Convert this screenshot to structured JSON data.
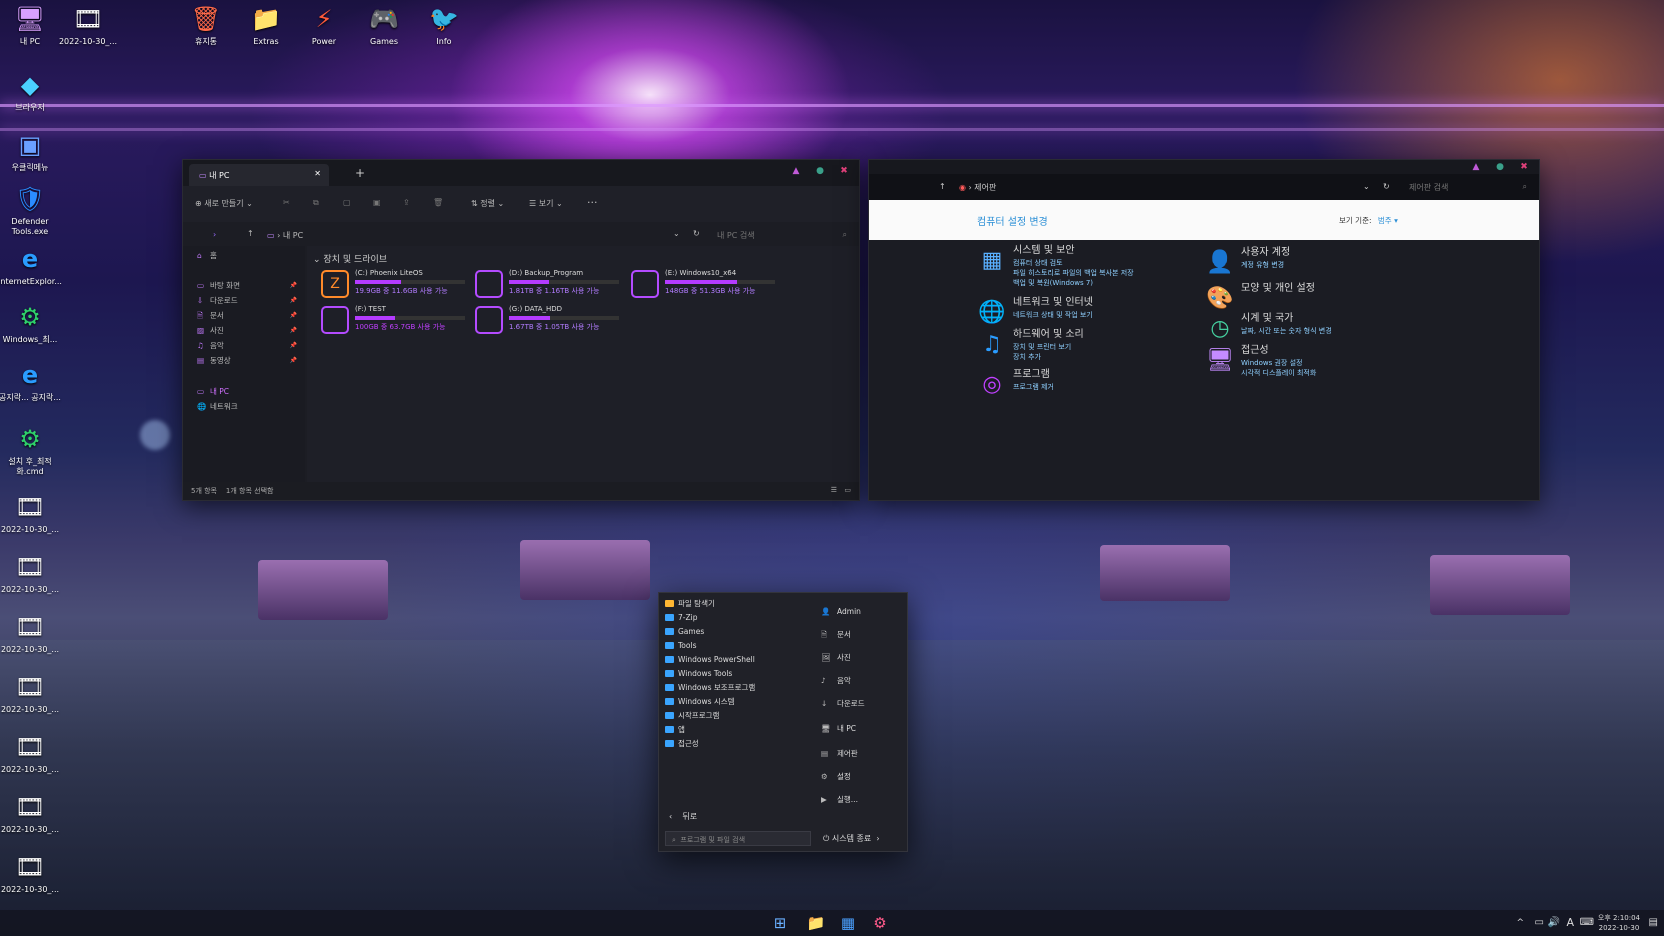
{
  "desktop": {
    "icons": [
      {
        "label": "내 PC",
        "glyph": "🖥"
      },
      {
        "label": "2022-10-30_...",
        "glyph": "🎞"
      },
      {
        "label": "휴지통",
        "glyph": "🗑"
      },
      {
        "label": "Extras",
        "glyph": "📁"
      },
      {
        "label": "Power",
        "glyph": "⚡"
      },
      {
        "label": "Games",
        "glyph": "🎮"
      },
      {
        "label": "Info",
        "glyph": "🐦"
      },
      {
        "label": "브라우저",
        "glyph": "◆"
      },
      {
        "label": "우클릭메뉴",
        "glyph": "▣"
      },
      {
        "label": "Defender Tools.exe",
        "glyph": "🛡"
      },
      {
        "label": "InternetExplor...",
        "glyph": "e"
      },
      {
        "label": "Windows_최...",
        "glyph": "⚙"
      },
      {
        "label": "공지락... 공지락...",
        "glyph": "e"
      },
      {
        "label": "설치 후_최적화.cmd",
        "glyph": "⚙"
      },
      {
        "label": "2022-10-30_...",
        "glyph": "🎞"
      },
      {
        "label": "2022-10-30_...",
        "glyph": "🎞"
      },
      {
        "label": "2022-10-30_...",
        "glyph": "🎞"
      },
      {
        "label": "2022-10-30_...",
        "glyph": "🎞"
      },
      {
        "label": "2022-10-30_...",
        "glyph": "🎞"
      },
      {
        "label": "2022-10-30_...",
        "glyph": "🎞"
      },
      {
        "label": "2022-10-30_..."
      }
    ]
  },
  "explorer": {
    "tab": "내 PC",
    "new_tab": "+",
    "toolbar": {
      "new": "새로 만들기",
      "sort": "정렬",
      "view": "보기",
      "more": "···"
    },
    "path": "내 PC",
    "search_placeholder": "내 PC 검색",
    "sidebar": {
      "home": "홈",
      "items": [
        "바탕 화면",
        "다운로드",
        "문서",
        "사진",
        "음악",
        "동영상"
      ],
      "this_pc": "내 PC",
      "network": "네트워크"
    },
    "section": "장치 및 드라이브",
    "drives": [
      {
        "name": "(C:) Phoenix LiteOS",
        "size": "19.9GB 중 11.6GB 사용 가능",
        "used": 0.42
      },
      {
        "name": "(D:) Backup_Program",
        "size": "1.81TB 중 1.16TB 사용 가능",
        "used": 0.36
      },
      {
        "name": "(E:) Windows10_x64",
        "size": "148GB 중 51.3GB 사용 가능",
        "used": 0.65
      },
      {
        "name": "(F:) TEST",
        "size": "100GB 중 63.7GB 사용 가능",
        "used": 0.36
      },
      {
        "name": "(G:) DATA_HDD",
        "size": "1.67TB 중 1.05TB 사용 가능",
        "used": 0.37
      }
    ],
    "status": {
      "count": "5개 항목",
      "selected": "1개 항목 선택함"
    }
  },
  "control_panel": {
    "path": "제어판",
    "search_placeholder": "제어판 검색",
    "heading": "컴퓨터 설정 변경",
    "view_by_label": "보기 기준:",
    "view_by_value": "범주",
    "left": [
      {
        "title": "시스템 및 보안",
        "subs": [
          "컴퓨터 상태 검토",
          "파일 히스토리로 파일의 백업 복사본 저장",
          "백업 및 복원(Windows 7)"
        ],
        "glyph": "▦"
      },
      {
        "title": "네트워크 및 인터넷",
        "subs": [
          "네트워크 상태 및 작업 보기"
        ],
        "glyph": "🌐"
      },
      {
        "title": "하드웨어 및 소리",
        "subs": [
          "장치 및 프린터 보기",
          "장치 추가"
        ],
        "glyph": "♫"
      },
      {
        "title": "프로그램",
        "subs": [
          "프로그램 제거"
        ],
        "glyph": "◎"
      }
    ],
    "right": [
      {
        "title": "사용자 계정",
        "subs": [
          "계정 유형 변경"
        ],
        "glyph": "👤"
      },
      {
        "title": "모양 및 개인 설정",
        "subs": [],
        "glyph": "🎨"
      },
      {
        "title": "시계 및 국가",
        "subs": [
          "날짜, 시간 또는 숫자 형식 변경"
        ],
        "glyph": "◷"
      },
      {
        "title": "접근성",
        "subs": [
          "Windows 권장 설정",
          "시각적 디스플레이 최적화"
        ],
        "glyph": "🖥"
      }
    ]
  },
  "start": {
    "left": [
      "파일 탐색기",
      "7-Zip",
      "Games",
      "Tools",
      "Windows PowerShell",
      "Windows Tools",
      "Windows 보조프로그램",
      "Windows 시스템",
      "시작프로그램",
      "앱",
      "접근성"
    ],
    "right": [
      {
        "label": "Admin",
        "glyph": "👤"
      },
      {
        "label": "문서",
        "glyph": "🗎"
      },
      {
        "label": "사진",
        "glyph": "🖼"
      },
      {
        "label": "음악",
        "glyph": "♪"
      },
      {
        "label": "다운로드",
        "glyph": "↓"
      },
      {
        "label": "내 PC",
        "glyph": "🖥"
      },
      {
        "label": "제어판",
        "glyph": "▤"
      },
      {
        "label": "설정",
        "glyph": "⚙"
      },
      {
        "label": "실행...",
        "glyph": "▶"
      }
    ],
    "back": "뒤로",
    "search_placeholder": "프로그램 및 파일 검색",
    "shutdown": "시스템 종료"
  },
  "taskbar": {
    "time": "오후 2:10:04",
    "date": "2022-10-30",
    "ime": "A",
    "tray": "^"
  },
  "colors": {
    "accent": "#b43bff",
    "link": "#3aa5ff",
    "panel_bg": "#1c1d24"
  }
}
